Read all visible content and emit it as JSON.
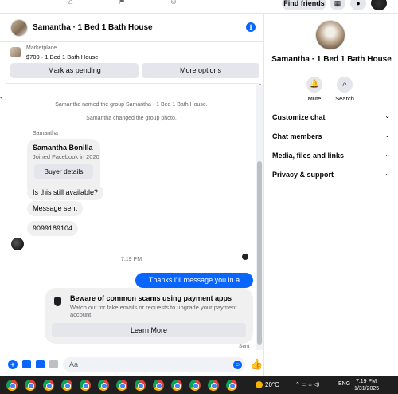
{
  "topnav": {
    "find_friends_label": "Find friends"
  },
  "chat": {
    "title": "Samantha · 1 Bed 1 Bath House",
    "marketplace_label": "Marketplace",
    "marketplace_item": "$700 · 1 Bed 1 Bath House",
    "mark_pending_label": "Mark as pending",
    "more_options_label": "More options",
    "system_messages": [
      "Samantha named the group Samantha · 1 Bed 1 Bath House.",
      "Samantha changed the group photo."
    ],
    "sender_name": "Samantha",
    "profile_card": {
      "name": "Samantha Bonilla",
      "joined": "Joined Facebook in 2020",
      "button_label": "Buyer details"
    },
    "incoming_messages": [
      "Is this still available?",
      "Message sent",
      "9099189104"
    ],
    "timestamp": "7:19 PM",
    "outgoing_message": "Thanks i\"il message you in a moment",
    "warning": {
      "title": "Beware of common scams using payment apps",
      "body": "Watch out for fake emails or requests to upgrade your payment account.",
      "button_label": "Learn More"
    },
    "sent_status": "Sent",
    "composer_placeholder": "Aa"
  },
  "right_panel": {
    "title": "Samantha · 1 Bed 1 Bath House",
    "mute_label": "Mute",
    "search_label": "Search",
    "sections": [
      "Customize chat",
      "Chat members",
      "Media, files and links",
      "Privacy & support"
    ]
  },
  "taskbar": {
    "temperature": "20°C",
    "language": "ENG",
    "time": "7:19 PM",
    "date": "1/31/2025"
  },
  "colors": {
    "accent": "#0866ff",
    "bubble_gray": "#f0f0f0",
    "button_gray": "#e4e6eb"
  }
}
